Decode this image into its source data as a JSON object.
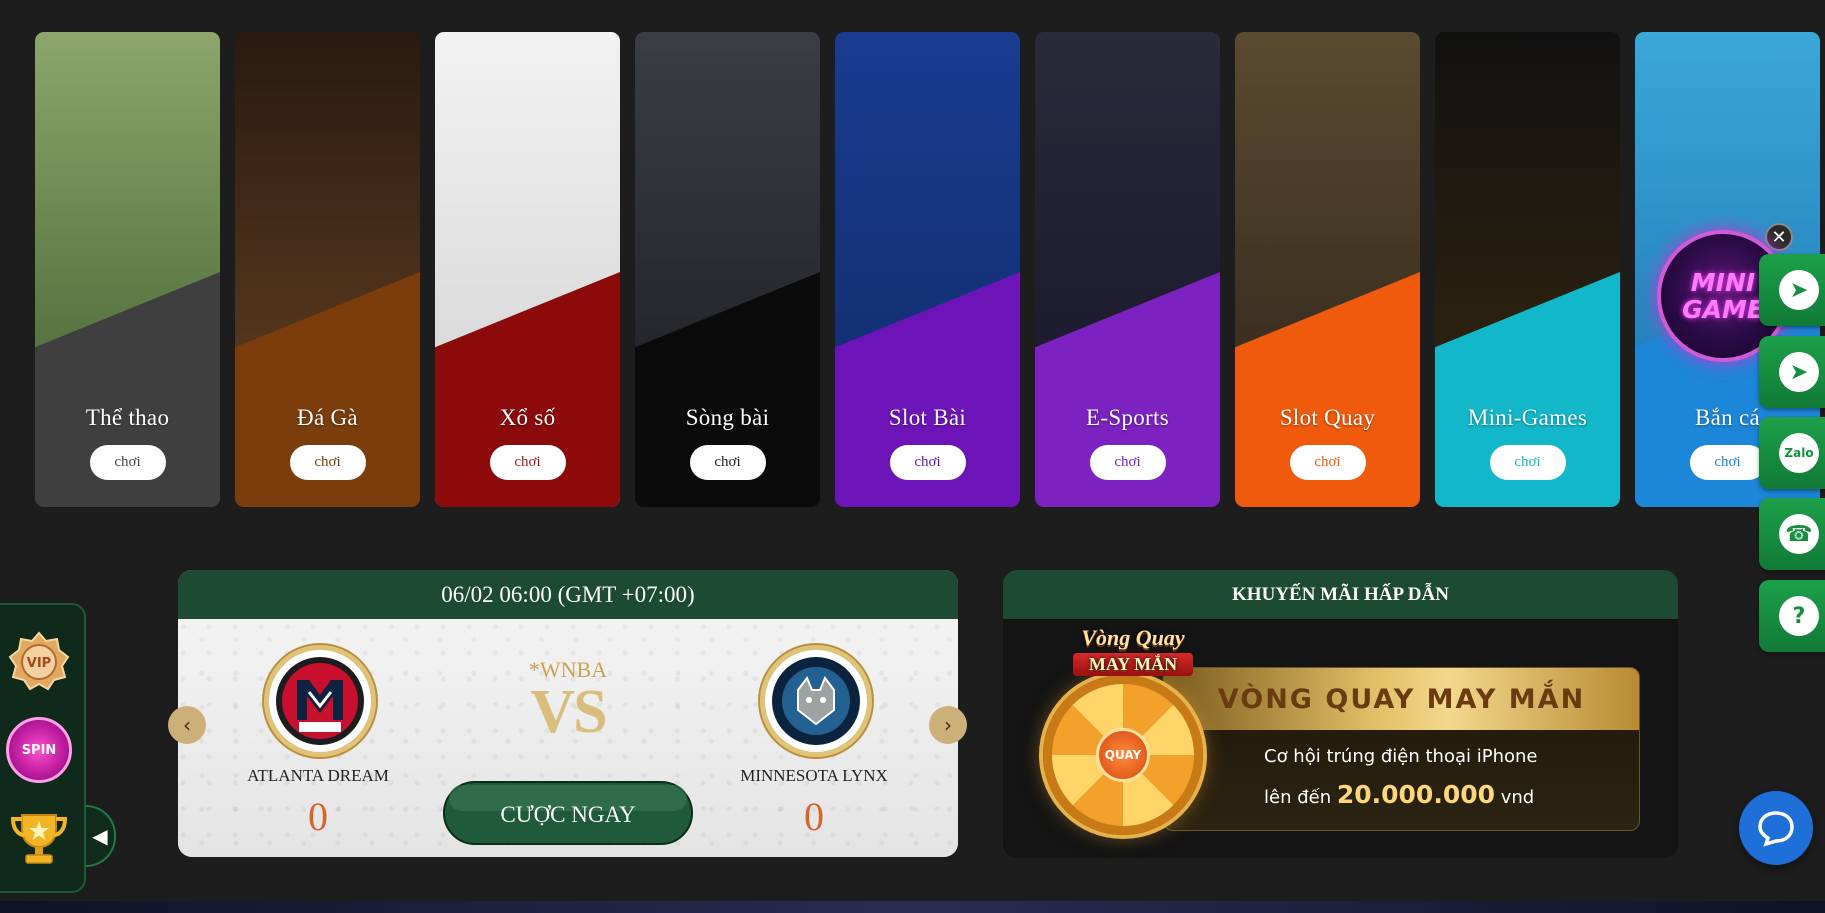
{
  "categories": [
    {
      "label": "Thể thao",
      "play": "chơi",
      "color": "#3f3f3f",
      "text_color": "#4a4a4a",
      "icon": "soccer-players-art"
    },
    {
      "label": "Đá Gà",
      "play": "chơi",
      "color": "#7a3d0b",
      "text_color": "#7a3d0b",
      "icon": "rooster-fight-art"
    },
    {
      "label": "Xổ số",
      "play": "chơi",
      "color": "#8c0a0a",
      "text_color": "#9a1a1a",
      "icon": "lottery-girl-art"
    },
    {
      "label": "Sòng bài",
      "play": "chơi",
      "color": "#0b0b0b",
      "text_color": "#222222",
      "icon": "casino-dealer-art"
    },
    {
      "label": "Slot Bài",
      "play": "chơi",
      "color": "#6d14b8",
      "text_color": "#6d14b8",
      "icon": "card-girl-art"
    },
    {
      "label": "E-Sports",
      "play": "chơi",
      "color": "#7b22c0",
      "text_color": "#7b22c0",
      "icon": "esports-hero-art"
    },
    {
      "label": "Slot Quay",
      "play": "chơi",
      "color": "#ef5a0c",
      "text_color": "#ef5a0c",
      "icon": "slot-man-art"
    },
    {
      "label": "Mini-Games",
      "play": "chơi",
      "color": "#12b7c9",
      "text_color": "#12b7c9",
      "icon": "poker-chip-art"
    },
    {
      "label": "Bắn cá",
      "play": "chơi",
      "color": "#1c86d8",
      "text_color": "#1c86d8",
      "icon": "fish-shark-art"
    }
  ],
  "side": {
    "close": "✕",
    "mini_game_badge": [
      "MINI",
      "GAME"
    ],
    "contacts": [
      {
        "name": "telegram-button",
        "icon": "telegram-icon",
        "glyph": "➤"
      },
      {
        "name": "telegram-group-button",
        "icon": "telegram-icon",
        "glyph": "➤"
      },
      {
        "name": "zalo-button",
        "icon": "zalo-icon",
        "glyph": "Zalo"
      },
      {
        "name": "support-agent-button",
        "icon": "headset-agent-icon",
        "glyph": "☎"
      },
      {
        "name": "help-button",
        "icon": "question-icon",
        "glyph": "?"
      }
    ]
  },
  "left_bar": {
    "vip": "VIP",
    "wheel": "SPIN",
    "toggle": "◀"
  },
  "match": {
    "datetime": "06/02 06:00 (GMT +07:00)",
    "league": "*WNBA",
    "vs": "VS",
    "home": {
      "name": "ATLANTA DREAM",
      "score": "0"
    },
    "away": {
      "name": "MINNESOTA LYNX",
      "score": "0"
    },
    "bet_button": "CƯỢC NGAY",
    "prev": "‹",
    "next": "›"
  },
  "promo": {
    "title": "KHUYẾN MÃI HẤP DẪN",
    "wheel_title": "Vòng Quay",
    "wheel_subtitle": "MAY MẮN",
    "wheel_center": "QUAY",
    "banner_heading": "VÒNG QUAY MAY MẮN",
    "line1": "Cơ hội trúng điện thoại iPhone",
    "line2_prefix": "lên đến",
    "line2_amount": "20.000.000",
    "line2_suffix": "vnd"
  }
}
